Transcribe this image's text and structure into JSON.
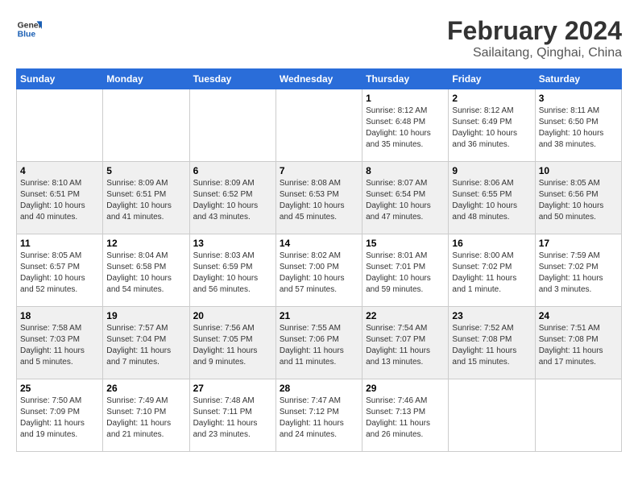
{
  "header": {
    "logo_general": "General",
    "logo_blue": "Blue",
    "title": "February 2024",
    "subtitle": "Sailaitang, Qinghai, China"
  },
  "calendar": {
    "columns": [
      "Sunday",
      "Monday",
      "Tuesday",
      "Wednesday",
      "Thursday",
      "Friday",
      "Saturday"
    ],
    "weeks": [
      {
        "shaded": false,
        "days": [
          {
            "number": "",
            "info": ""
          },
          {
            "number": "",
            "info": ""
          },
          {
            "number": "",
            "info": ""
          },
          {
            "number": "",
            "info": ""
          },
          {
            "number": "1",
            "info": "Sunrise: 8:12 AM\nSunset: 6:48 PM\nDaylight: 10 hours\nand 35 minutes."
          },
          {
            "number": "2",
            "info": "Sunrise: 8:12 AM\nSunset: 6:49 PM\nDaylight: 10 hours\nand 36 minutes."
          },
          {
            "number": "3",
            "info": "Sunrise: 8:11 AM\nSunset: 6:50 PM\nDaylight: 10 hours\nand 38 minutes."
          }
        ]
      },
      {
        "shaded": true,
        "days": [
          {
            "number": "4",
            "info": "Sunrise: 8:10 AM\nSunset: 6:51 PM\nDaylight: 10 hours\nand 40 minutes."
          },
          {
            "number": "5",
            "info": "Sunrise: 8:09 AM\nSunset: 6:51 PM\nDaylight: 10 hours\nand 41 minutes."
          },
          {
            "number": "6",
            "info": "Sunrise: 8:09 AM\nSunset: 6:52 PM\nDaylight: 10 hours\nand 43 minutes."
          },
          {
            "number": "7",
            "info": "Sunrise: 8:08 AM\nSunset: 6:53 PM\nDaylight: 10 hours\nand 45 minutes."
          },
          {
            "number": "8",
            "info": "Sunrise: 8:07 AM\nSunset: 6:54 PM\nDaylight: 10 hours\nand 47 minutes."
          },
          {
            "number": "9",
            "info": "Sunrise: 8:06 AM\nSunset: 6:55 PM\nDaylight: 10 hours\nand 48 minutes."
          },
          {
            "number": "10",
            "info": "Sunrise: 8:05 AM\nSunset: 6:56 PM\nDaylight: 10 hours\nand 50 minutes."
          }
        ]
      },
      {
        "shaded": false,
        "days": [
          {
            "number": "11",
            "info": "Sunrise: 8:05 AM\nSunset: 6:57 PM\nDaylight: 10 hours\nand 52 minutes."
          },
          {
            "number": "12",
            "info": "Sunrise: 8:04 AM\nSunset: 6:58 PM\nDaylight: 10 hours\nand 54 minutes."
          },
          {
            "number": "13",
            "info": "Sunrise: 8:03 AM\nSunset: 6:59 PM\nDaylight: 10 hours\nand 56 minutes."
          },
          {
            "number": "14",
            "info": "Sunrise: 8:02 AM\nSunset: 7:00 PM\nDaylight: 10 hours\nand 57 minutes."
          },
          {
            "number": "15",
            "info": "Sunrise: 8:01 AM\nSunset: 7:01 PM\nDaylight: 10 hours\nand 59 minutes."
          },
          {
            "number": "16",
            "info": "Sunrise: 8:00 AM\nSunset: 7:02 PM\nDaylight: 11 hours\nand 1 minute."
          },
          {
            "number": "17",
            "info": "Sunrise: 7:59 AM\nSunset: 7:02 PM\nDaylight: 11 hours\nand 3 minutes."
          }
        ]
      },
      {
        "shaded": true,
        "days": [
          {
            "number": "18",
            "info": "Sunrise: 7:58 AM\nSunset: 7:03 PM\nDaylight: 11 hours\nand 5 minutes."
          },
          {
            "number": "19",
            "info": "Sunrise: 7:57 AM\nSunset: 7:04 PM\nDaylight: 11 hours\nand 7 minutes."
          },
          {
            "number": "20",
            "info": "Sunrise: 7:56 AM\nSunset: 7:05 PM\nDaylight: 11 hours\nand 9 minutes."
          },
          {
            "number": "21",
            "info": "Sunrise: 7:55 AM\nSunset: 7:06 PM\nDaylight: 11 hours\nand 11 minutes."
          },
          {
            "number": "22",
            "info": "Sunrise: 7:54 AM\nSunset: 7:07 PM\nDaylight: 11 hours\nand 13 minutes."
          },
          {
            "number": "23",
            "info": "Sunrise: 7:52 AM\nSunset: 7:08 PM\nDaylight: 11 hours\nand 15 minutes."
          },
          {
            "number": "24",
            "info": "Sunrise: 7:51 AM\nSunset: 7:08 PM\nDaylight: 11 hours\nand 17 minutes."
          }
        ]
      },
      {
        "shaded": false,
        "days": [
          {
            "number": "25",
            "info": "Sunrise: 7:50 AM\nSunset: 7:09 PM\nDaylight: 11 hours\nand 19 minutes."
          },
          {
            "number": "26",
            "info": "Sunrise: 7:49 AM\nSunset: 7:10 PM\nDaylight: 11 hours\nand 21 minutes."
          },
          {
            "number": "27",
            "info": "Sunrise: 7:48 AM\nSunset: 7:11 PM\nDaylight: 11 hours\nand 23 minutes."
          },
          {
            "number": "28",
            "info": "Sunrise: 7:47 AM\nSunset: 7:12 PM\nDaylight: 11 hours\nand 24 minutes."
          },
          {
            "number": "29",
            "info": "Sunrise: 7:46 AM\nSunset: 7:13 PM\nDaylight: 11 hours\nand 26 minutes."
          },
          {
            "number": "",
            "info": ""
          },
          {
            "number": "",
            "info": ""
          }
        ]
      }
    ]
  }
}
